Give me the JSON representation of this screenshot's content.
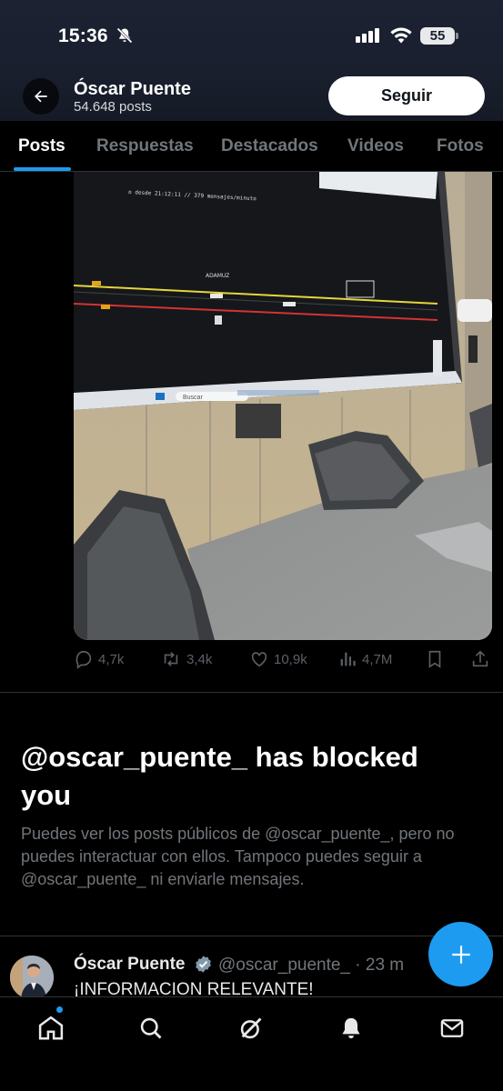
{
  "status_bar": {
    "time": "15:36",
    "battery": "55"
  },
  "header": {
    "profile_name": "Óscar Puente",
    "post_count": "54.648 posts",
    "follow_label": "Seguir"
  },
  "tabs": [
    {
      "label": "Posts",
      "active": true
    },
    {
      "label": "Respuestas",
      "active": false
    },
    {
      "label": "Destacados",
      "active": false
    },
    {
      "label": "Videos",
      "active": false
    },
    {
      "label": "Fotos",
      "active": false
    }
  ],
  "media": {
    "screen_header": "o desde 21:12:11 // 379 mensajes/minuto",
    "station_label": "ADAMUZ",
    "taskbar_search": "Buscar"
  },
  "post_actions": {
    "replies": "4,7k",
    "reposts": "3,4k",
    "likes": "10,9k",
    "views": "4,7M"
  },
  "blocked_notice": {
    "title": "@oscar_puente_ has blocked you",
    "description": "Puedes ver los posts públicos de @oscar_puente_, pero no puedes interactuar con ellos. Tampoco puedes seguir a @oscar_puente_ ni enviarle mensajes."
  },
  "next_post": {
    "author": "Óscar Puente",
    "handle": "@oscar_puente_ · 23 m",
    "text": "¡INFORMACION RELEVANTE!"
  },
  "colors": {
    "accent": "#1d9bf0",
    "muted": "#71767b",
    "background": "#000000"
  },
  "icons": [
    "back-arrow-icon",
    "bell-off-icon",
    "signal-icon",
    "wifi-icon",
    "reply-icon",
    "repost-icon",
    "like-icon",
    "views-icon",
    "bookmark-icon",
    "share-icon",
    "verified-icon",
    "compose-plus-icon",
    "home-icon",
    "search-icon",
    "grok-icon",
    "notifications-icon",
    "messages-icon"
  ]
}
